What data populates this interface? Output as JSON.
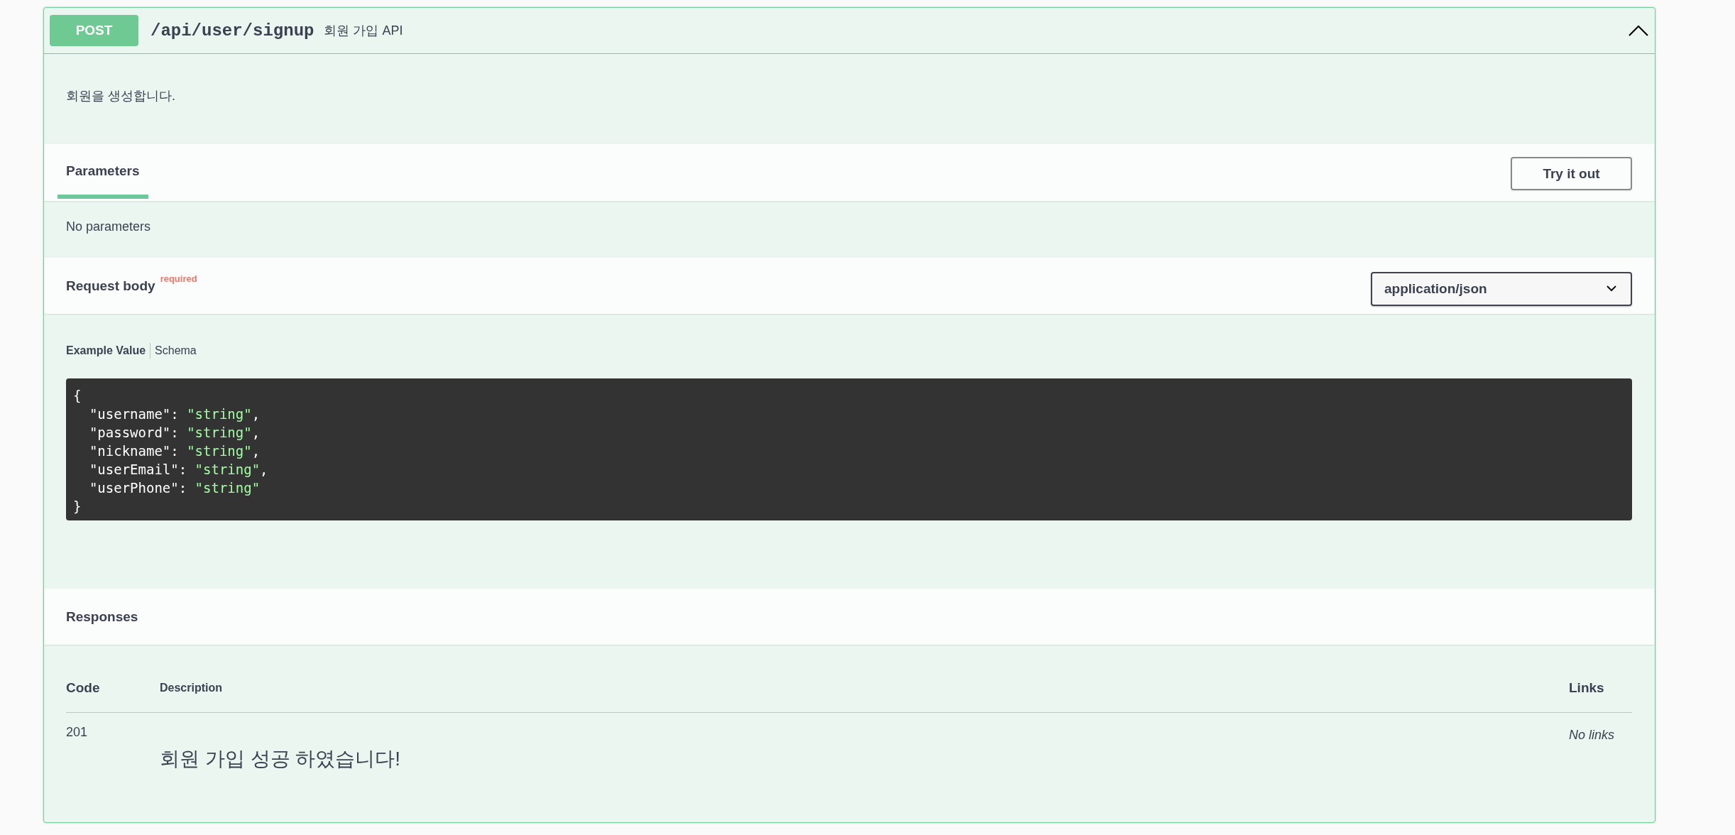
{
  "operation": {
    "method": "POST",
    "path": "/api/user/signup",
    "summary": "회원 가입 API",
    "expanded": true,
    "description": "회원을 생성합니다."
  },
  "parameters": {
    "tabs": [
      {
        "label": "Parameters",
        "selected": true
      }
    ],
    "try_button": "Try it out",
    "empty_text": "No parameters"
  },
  "request_body": {
    "title": "Request body",
    "required_label": "required",
    "content_type": "application/json",
    "example_tabs": [
      {
        "label": "Example Value",
        "selected": true
      },
      {
        "label": "Schema",
        "selected": false
      }
    ],
    "example_lines": [
      [
        {
          "kind": "plain",
          "text": "{"
        }
      ],
      [
        {
          "kind": "plain",
          "text": "  \"username\": "
        },
        {
          "kind": "string",
          "text": "\"string\""
        },
        {
          "kind": "plain",
          "text": ","
        }
      ],
      [
        {
          "kind": "plain",
          "text": "  \"password\": "
        },
        {
          "kind": "string",
          "text": "\"string\""
        },
        {
          "kind": "plain",
          "text": ","
        }
      ],
      [
        {
          "kind": "plain",
          "text": "  \"nickname\": "
        },
        {
          "kind": "string",
          "text": "\"string\""
        },
        {
          "kind": "plain",
          "text": ","
        }
      ],
      [
        {
          "kind": "plain",
          "text": "  \"userEmail\": "
        },
        {
          "kind": "string",
          "text": "\"string\""
        },
        {
          "kind": "plain",
          "text": ","
        }
      ],
      [
        {
          "kind": "plain",
          "text": "  \"userPhone\": "
        },
        {
          "kind": "string",
          "text": "\"string\""
        }
      ],
      [
        {
          "kind": "plain",
          "text": "}"
        }
      ]
    ]
  },
  "responses": {
    "title": "Responses",
    "columns": [
      "Code",
      "Description",
      "Links"
    ],
    "rows": [
      {
        "code": "201",
        "description": "회원 가입 성공 하였습니다!",
        "links": "No links"
      }
    ]
  }
}
